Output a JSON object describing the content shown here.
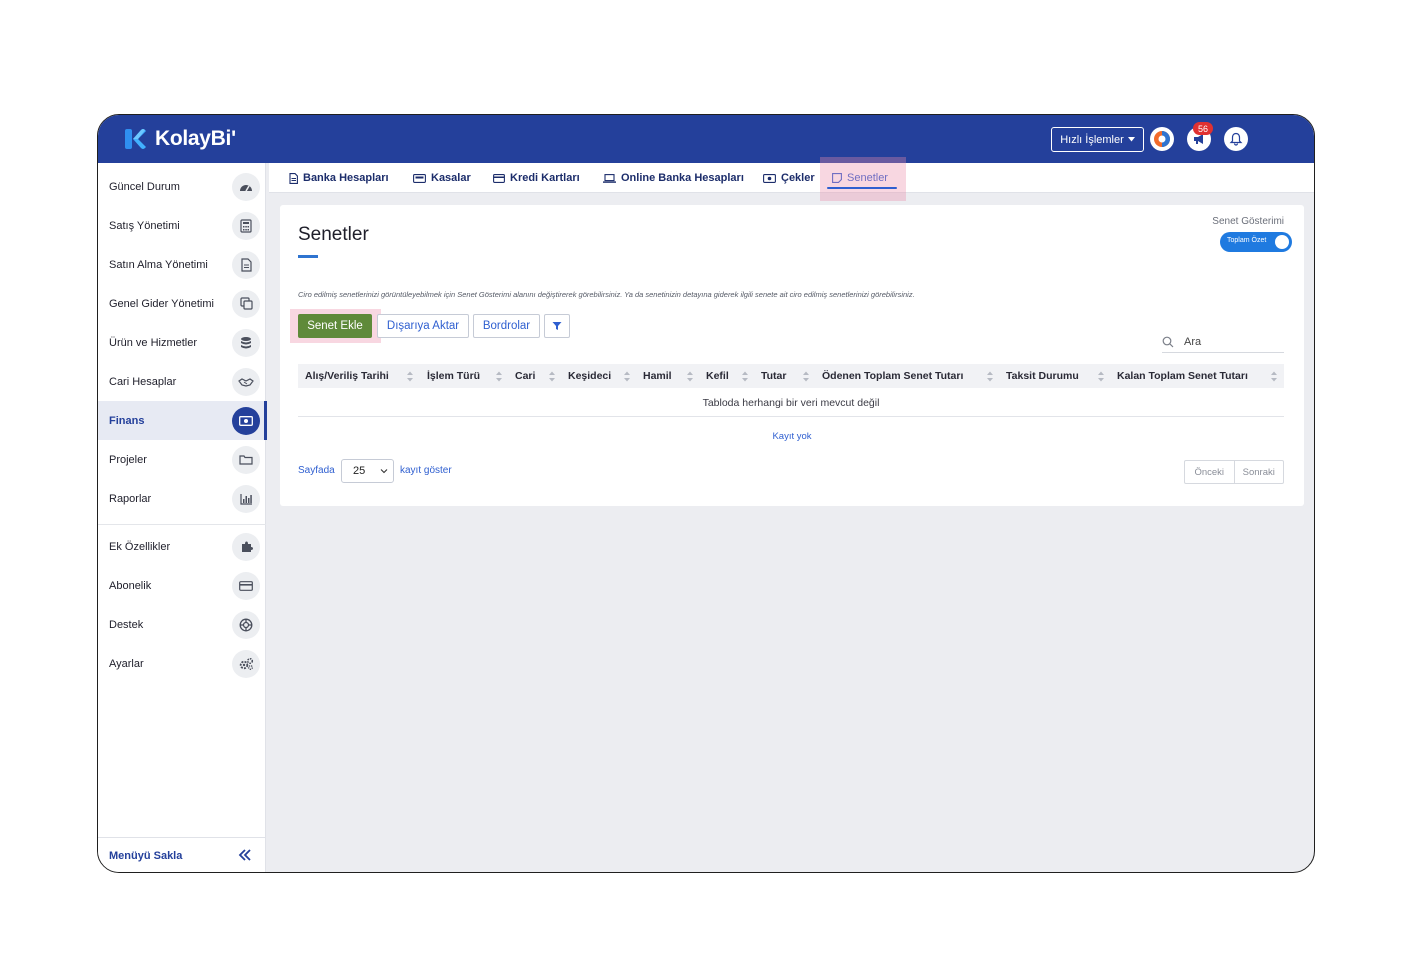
{
  "app": {
    "logo_text": "KolayBi'",
    "quick_actions_label": "Hızlı İşlemler",
    "notification_count": "56"
  },
  "sidebar": {
    "items": [
      {
        "label": "Güncel Durum",
        "icon": "dashboard-icon"
      },
      {
        "label": "Satış Yönetimi",
        "icon": "calculator-icon"
      },
      {
        "label": "Satın Alma Yönetimi",
        "icon": "document-icon"
      },
      {
        "label": "Genel Gider Yönetimi",
        "icon": "copy-icon"
      },
      {
        "label": "Ürün ve Hizmetler",
        "icon": "database-icon"
      },
      {
        "label": "Cari Hesaplar",
        "icon": "handshake-icon"
      },
      {
        "label": "Finans",
        "icon": "money-icon",
        "active": true
      },
      {
        "label": "Projeler",
        "icon": "folder-icon"
      },
      {
        "label": "Raporlar",
        "icon": "chart-icon"
      },
      {
        "label": "Ek Özellikler",
        "icon": "puzzle-icon"
      },
      {
        "label": "Abonelik",
        "icon": "credit-card-icon"
      },
      {
        "label": "Destek",
        "icon": "lifebuoy-icon"
      },
      {
        "label": "Ayarlar",
        "icon": "gears-icon"
      }
    ],
    "hide_menu_label": "Menüyü Sakla"
  },
  "tabs": [
    {
      "label": "Banka Hesapları",
      "icon": "document-icon"
    },
    {
      "label": "Kasalar",
      "icon": "cash-register-icon"
    },
    {
      "label": "Kredi Kartları",
      "icon": "credit-card-icon"
    },
    {
      "label": "Online Banka Hesapları",
      "icon": "laptop-icon"
    },
    {
      "label": "Çekler",
      "icon": "money-icon"
    },
    {
      "label": "Senetler",
      "icon": "note-icon",
      "active": true
    }
  ],
  "page": {
    "title": "Senetler",
    "view_label": "Senet Gösterimi",
    "toggle_label": "Toplam Özet",
    "toggle_on": true,
    "info_text": "Ciro edilmiş senetlerinizi görüntüleyebilmek için Senet Gösterimi alanını değiştirerek görebilirsiniz. Ya da senetinizin detayına giderek ilgili senete ait ciro edilmiş senetlerinizi görebilirsiniz.",
    "buttons": {
      "add": "Senet Ekle",
      "export": "Dışarıya Aktar",
      "bordro": "Bordrolar"
    },
    "search_placeholder": "Ara",
    "table": {
      "columns": [
        "Alış/Veriliş Tarihi",
        "İşlem Türü",
        "Cari",
        "Keşideci",
        "Hamil",
        "Kefil",
        "Tutar",
        "Ödenen Toplam Senet Tutarı",
        "Taksit Durumu",
        "Kalan Toplam Senet Tutarı"
      ],
      "empty_text": "Tabloda herhangi bir veri mevcut değil"
    },
    "no_record": "Kayıt yok",
    "per_page_prefix": "Sayfada",
    "per_page_value": "25",
    "per_page_suffix": "kayıt göster",
    "prev_label": "Önceki",
    "next_label": "Sonraki"
  },
  "colors": {
    "brand": "#24409b",
    "accent": "#2f5fd0",
    "add_button": "#5f8a3a",
    "toggle": "#1f7ae0",
    "badge": "#e03131"
  }
}
